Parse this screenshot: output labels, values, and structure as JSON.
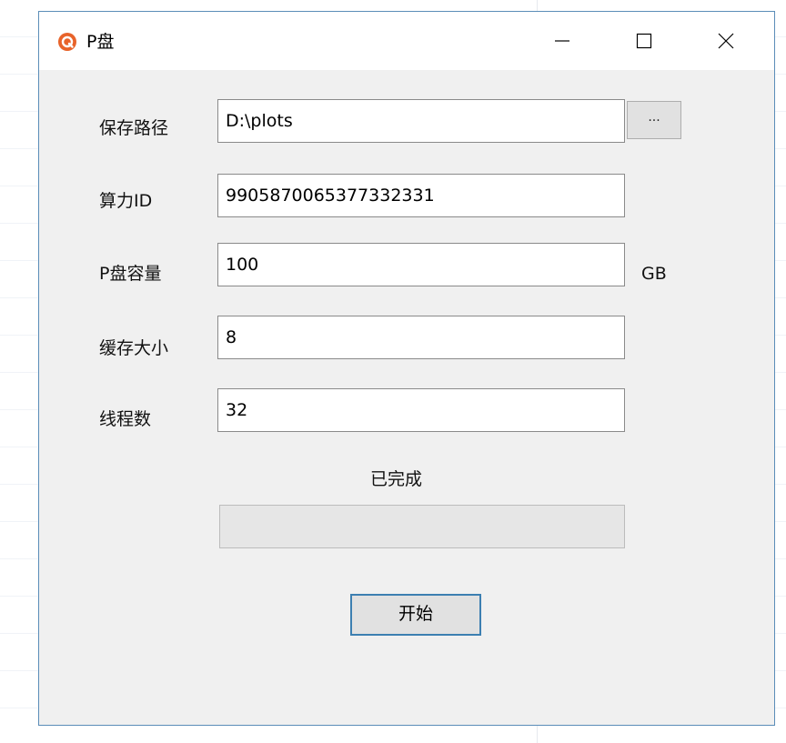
{
  "window": {
    "title": "P盘"
  },
  "form": {
    "save_path": {
      "label": "保存路径",
      "value": "D:\\plots",
      "browse_label": "..."
    },
    "compute_id": {
      "label": "算力ID",
      "value": "9905870065377332331"
    },
    "plot_capacity": {
      "label": "P盘容量",
      "value": "100",
      "unit": "GB"
    },
    "cache_size": {
      "label": "缓存大小",
      "value": "8"
    },
    "threads": {
      "label": "线程数",
      "value": "32"
    }
  },
  "status": {
    "text": "已完成",
    "progress": 0
  },
  "actions": {
    "start_label": "开始"
  },
  "icons": {
    "app": "app-logo-icon",
    "minimize": "minimize-icon",
    "maximize": "maximize-icon",
    "close": "close-icon"
  },
  "colors": {
    "accent": "#3c7fb1",
    "app_icon": "#e8632a",
    "progress_fill": "#06b025"
  }
}
